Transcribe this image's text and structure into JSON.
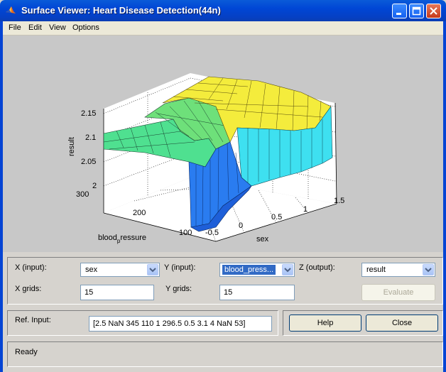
{
  "window": {
    "title": "Surface Viewer: Heart Disease Detection(44n)",
    "icon": "matlab-icon"
  },
  "menu": [
    "File",
    "Edit",
    "View",
    "Options"
  ],
  "plot": {
    "zlabel": "result",
    "xlabel": "sex",
    "ylabel_main": "blood",
    "ylabel_sub": "p",
    "ylabel_rest": "ressure",
    "z_ticks": [
      "2.15",
      "2.1",
      "2.05",
      "2"
    ],
    "y_ticks": [
      "300",
      "200",
      "100"
    ],
    "x_ticks": [
      "-0.5",
      "0",
      "0.5",
      "1",
      "1.5"
    ]
  },
  "controls": {
    "x_input_label": "X (input):",
    "x_input_value": "sex",
    "y_input_label": "Y (input):",
    "y_input_value": "blood_press...",
    "z_output_label": "Z (output):",
    "z_output_value": "result",
    "x_grids_label": "X grids:",
    "x_grids_value": "15",
    "y_grids_label": "Y grids:",
    "y_grids_value": "15",
    "evaluate_label": "Evaluate"
  },
  "ref": {
    "label": "Ref. Input:",
    "value": "[2.5 NaN 345 110 1 296.5 0.5 3.1 4 NaN 53]",
    "help_label": "Help",
    "close_label": "Close"
  },
  "status": "Ready"
}
